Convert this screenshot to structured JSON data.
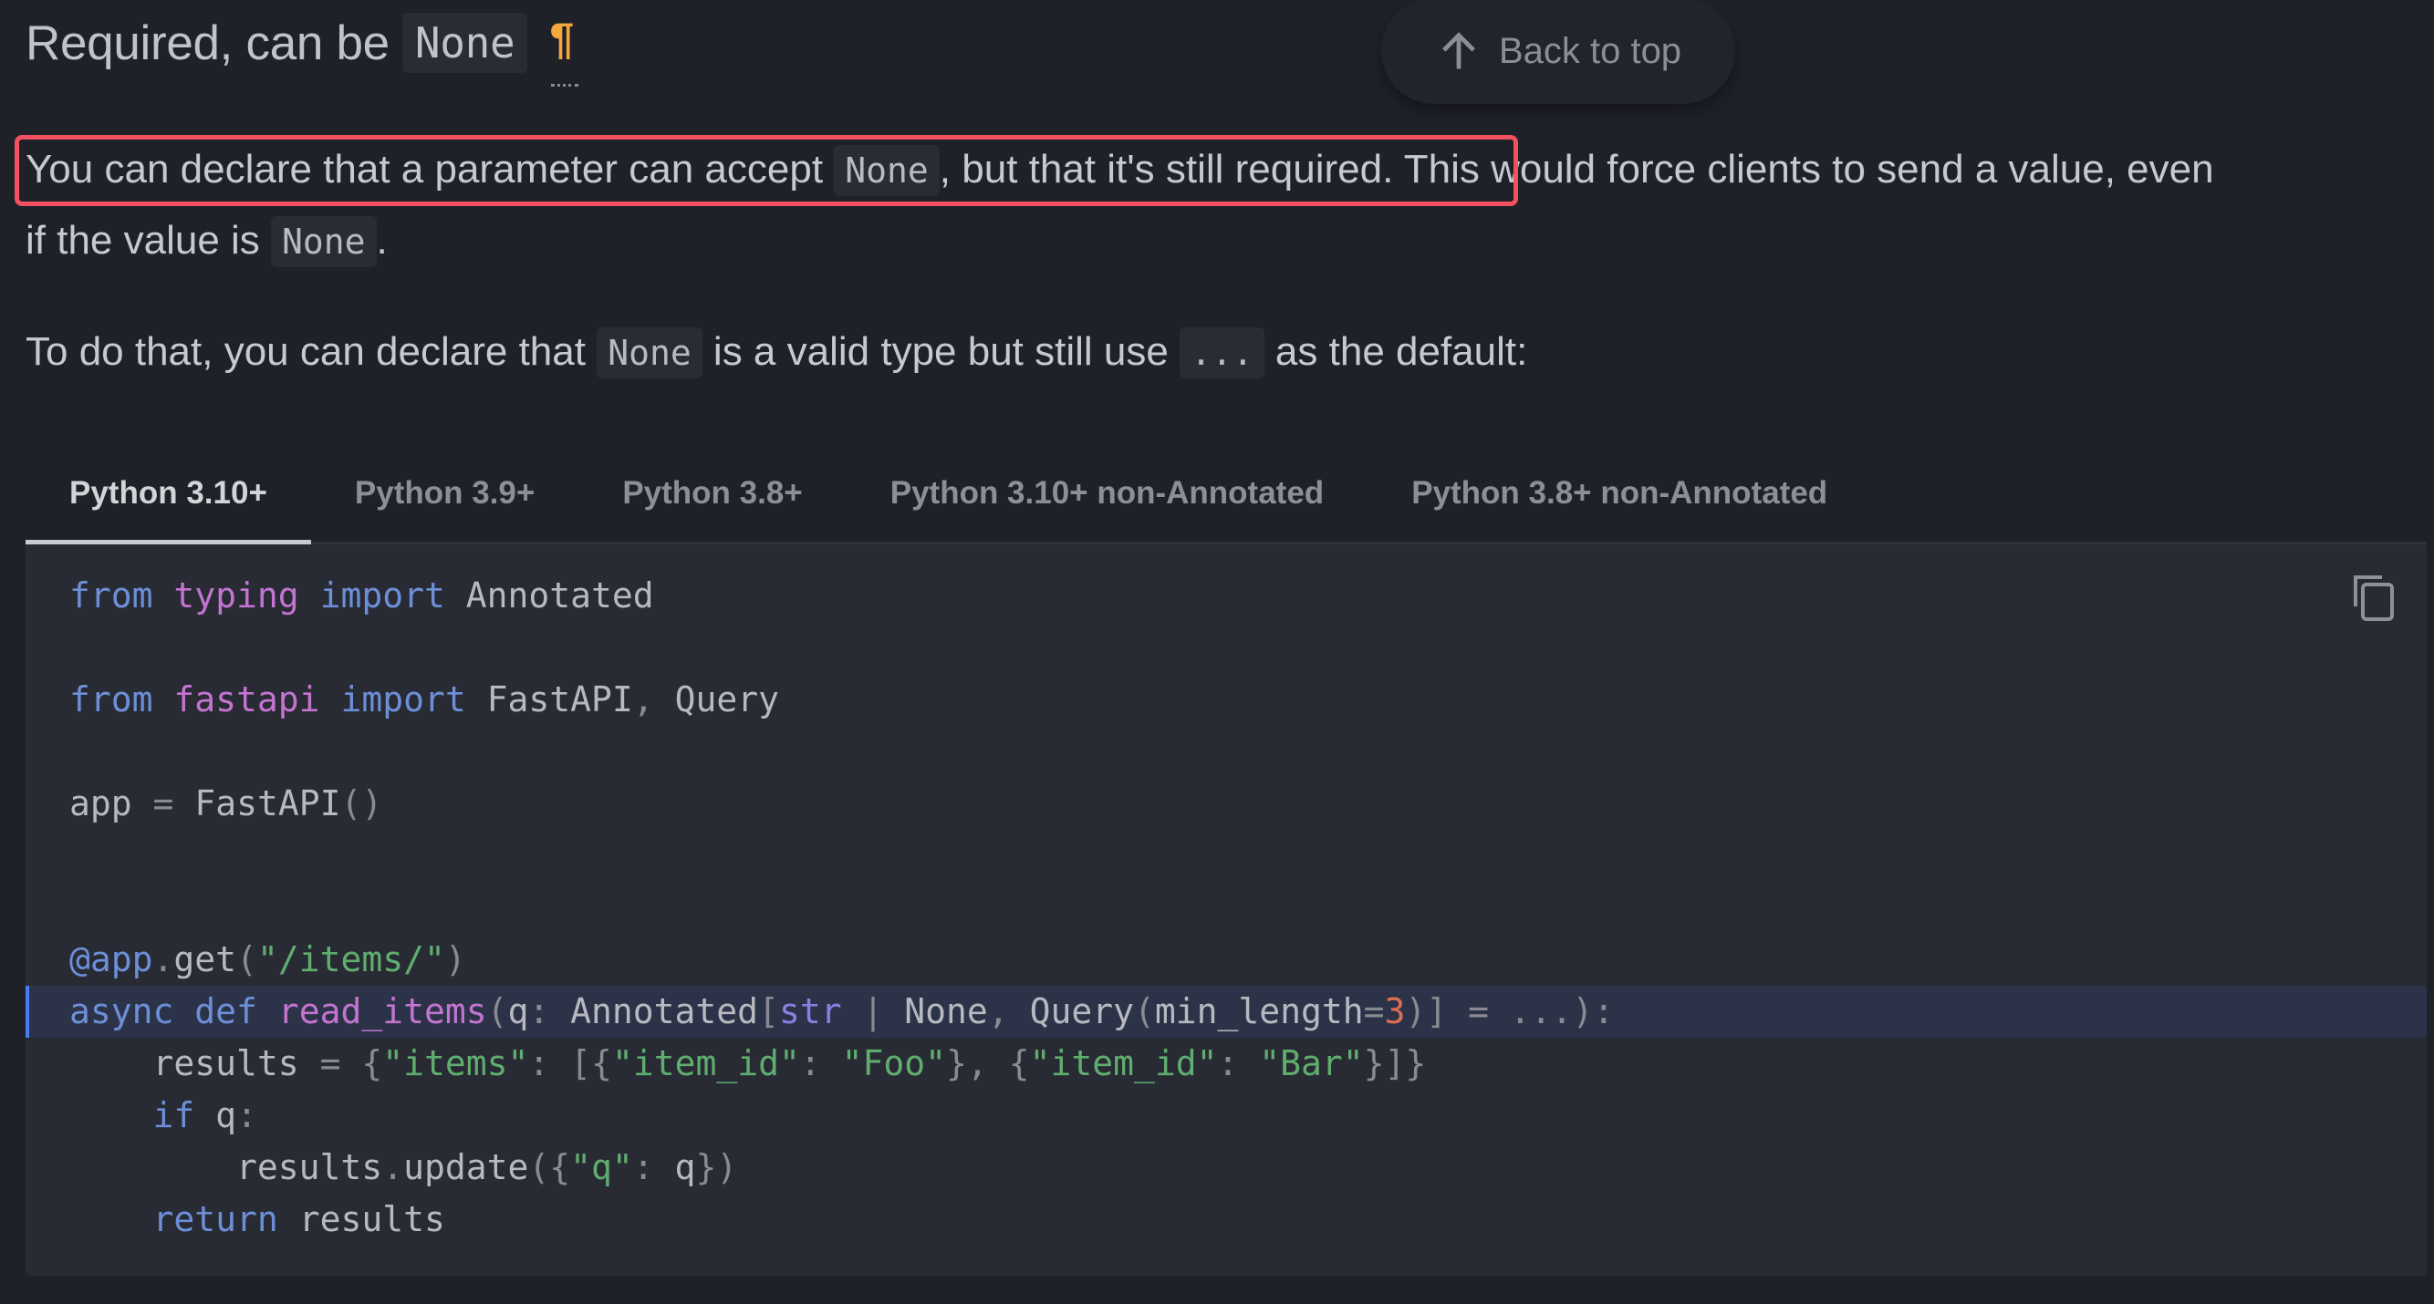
{
  "heading": {
    "text": "Required, can be",
    "code": "None",
    "anchor_symbol": "¶",
    "anchor_color": "#f5a83a"
  },
  "back_to_top": {
    "label": "Back to top",
    "icon": "arrow-up-icon"
  },
  "paragraph1": {
    "part1": "You can declare that a parameter can accept ",
    "code1": "None",
    "part2": ", but that it's still required.",
    "part3": " This would force clients to send a value, even",
    "line2_part1": "if the value is ",
    "code2": "None",
    "line2_part2": ".",
    "highlight_color": "#f2515f"
  },
  "paragraph2": {
    "part1": "To do that, you can declare that ",
    "code1": "None",
    "part2": " is a valid type but still use ",
    "code2": "...",
    "part3": " as the default:"
  },
  "tabs": [
    {
      "label": "Python 3.10+",
      "active": true
    },
    {
      "label": "Python 3.9+",
      "active": false
    },
    {
      "label": "Python 3.8+",
      "active": false
    },
    {
      "label": "Python 3.10+ non-Annotated",
      "active": false
    },
    {
      "label": "Python 3.8+ non-Annotated",
      "active": false
    }
  ],
  "code": {
    "copy_icon": "copy-icon",
    "highlighted_line": 7,
    "lines": [
      "from typing import Annotated",
      "",
      "from fastapi import FastAPI, Query",
      "",
      "app = FastAPI()",
      "",
      "",
      "@app.get(\"/items/\")",
      "async def read_items(q: Annotated[str | None, Query(min_length=3)] = ...):",
      "    results = {\"items\": [{\"item_id\": \"Foo\"}, {\"item_id\": \"Bar\"}]}",
      "    if q:",
      "        results.update({\"q\": q})",
      "    return results"
    ],
    "tokens": {
      "from": "from",
      "import": "import",
      "typing": "typing",
      "Annotated": "Annotated",
      "fastapi": "fastapi",
      "FastAPI": "FastAPI",
      "Query": "Query",
      "app": "app",
      "at_app": "@app",
      "get": "get",
      "route": "\"/items/\"",
      "async": "async",
      "def": "def",
      "read_items": "read_items",
      "q": "q",
      "str": "str",
      "None": "None",
      "min_length": "min_length",
      "three": "3",
      "ellipsis": "...",
      "results": "results",
      "items_key": "\"items\"",
      "item_id_key": "\"item_id\"",
      "foo": "\"Foo\"",
      "bar": "\"Bar\"",
      "if": "if",
      "update": "update",
      "q_key": "\"q\"",
      "return": "return"
    }
  }
}
